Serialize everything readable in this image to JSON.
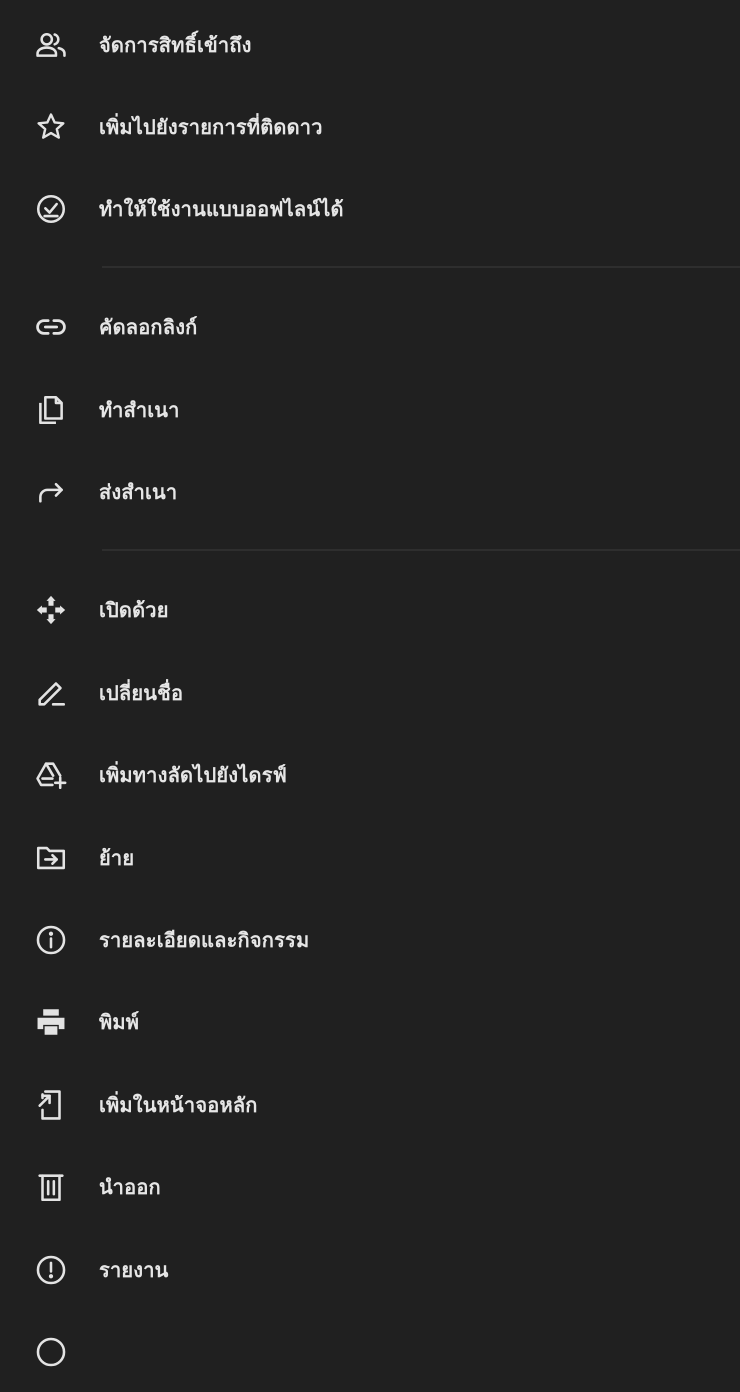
{
  "menu": {
    "items": [
      {
        "label": "จัดการสิทธิ์เข้าถึง",
        "icon": "people-icon"
      },
      {
        "label": "เพิ่มไปยังรายการที่ติดดาว",
        "icon": "star-icon"
      },
      {
        "label": "ทำให้ใช้งานแบบออฟไลน์ได้",
        "icon": "offline-check-icon"
      },
      {
        "label": "คัดลอกลิงก์",
        "icon": "link-icon"
      },
      {
        "label": "ทำสำเนา",
        "icon": "copy-icon"
      },
      {
        "label": "ส่งสำเนา",
        "icon": "share-arrow-icon"
      },
      {
        "label": "เปิดด้วย",
        "icon": "open-with-icon"
      },
      {
        "label": "เปลี่ยนชื่อ",
        "icon": "pencil-icon"
      },
      {
        "label": "เพิ่มทางลัดไปยังไดรฟ์",
        "icon": "drive-shortcut-icon"
      },
      {
        "label": "ย้าย",
        "icon": "move-folder-icon"
      },
      {
        "label": "รายละเอียดและกิจกรรม",
        "icon": "info-icon"
      },
      {
        "label": "พิมพ์",
        "icon": "printer-icon"
      },
      {
        "label": "เพิ่มในหน้าจอหลัก",
        "icon": "add-home-screen-icon"
      },
      {
        "label": "นำออก",
        "icon": "trash-icon"
      },
      {
        "label": "รายงาน",
        "icon": "report-icon"
      }
    ]
  },
  "colors": {
    "background": "#202020",
    "text": "#e6e6e6",
    "icon": "#e3e3e3",
    "divider": "#2e2e2e"
  }
}
